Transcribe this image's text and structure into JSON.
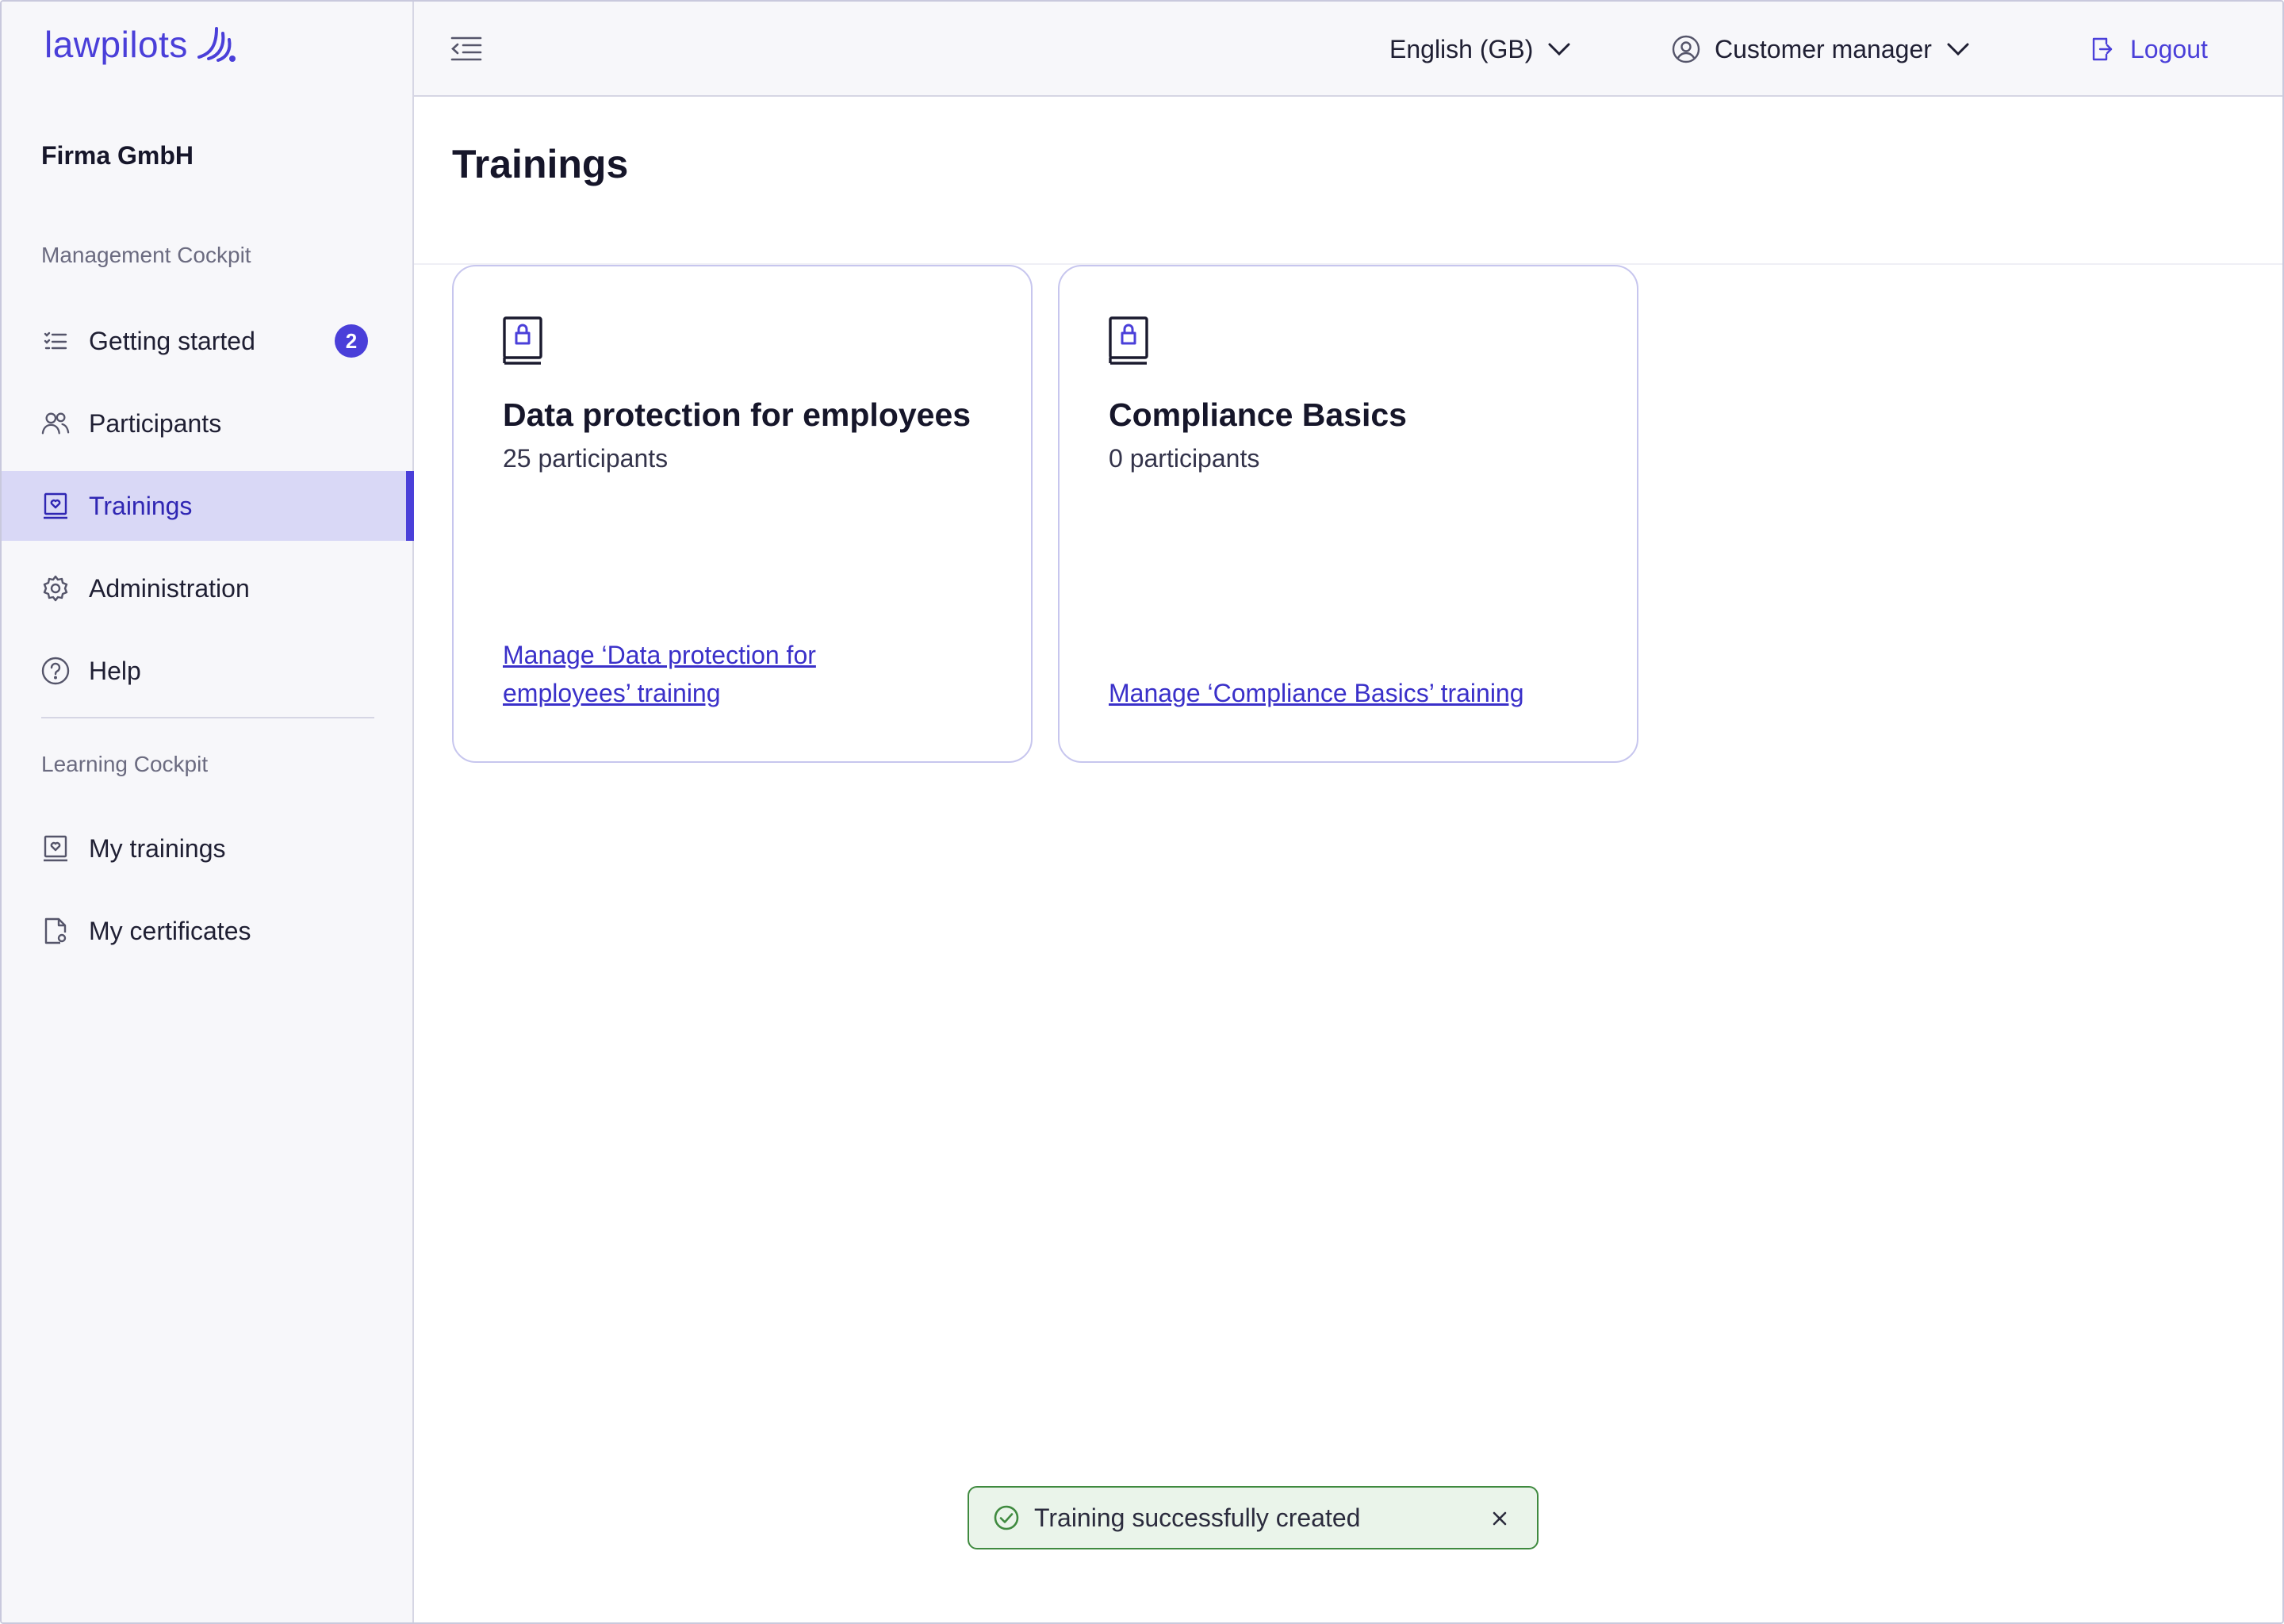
{
  "app": {
    "logo_text": "lawpilots",
    "org_name": "Firma GmbH"
  },
  "sidebar": {
    "management_label": "Management Cockpit",
    "learning_label": "Learning Cockpit",
    "items": [
      {
        "label": "Getting started",
        "icon": "checklist-icon",
        "badge": "2"
      },
      {
        "label": "Participants",
        "icon": "users-icon"
      },
      {
        "label": "Trainings",
        "icon": "training-icon",
        "active": true
      },
      {
        "label": "Administration",
        "icon": "gear-icon"
      },
      {
        "label": "Help",
        "icon": "help-icon"
      },
      {
        "label": "My trainings",
        "icon": "training-icon"
      },
      {
        "label": "My certificates",
        "icon": "certificate-icon"
      }
    ]
  },
  "topbar": {
    "language": "English (GB)",
    "role": "Customer manager",
    "logout": "Logout"
  },
  "main": {
    "title": "Trainings",
    "cards": [
      {
        "title": "Data protection for employees",
        "participants": "25 participants",
        "link_line1": "Manage ‘Data protection for",
        "link_line2": "employees’ training"
      },
      {
        "title": "Compliance Basics",
        "participants": "0 participants",
        "link": "Manage ‘Compliance Basics’ training"
      }
    ]
  },
  "toast": {
    "message": "Training successfully created"
  },
  "colors": {
    "accent": "#4a3fd9",
    "active_bg": "#d9d8f6",
    "success_bg": "#eaf4ea",
    "success_border": "#3f8a3f"
  }
}
